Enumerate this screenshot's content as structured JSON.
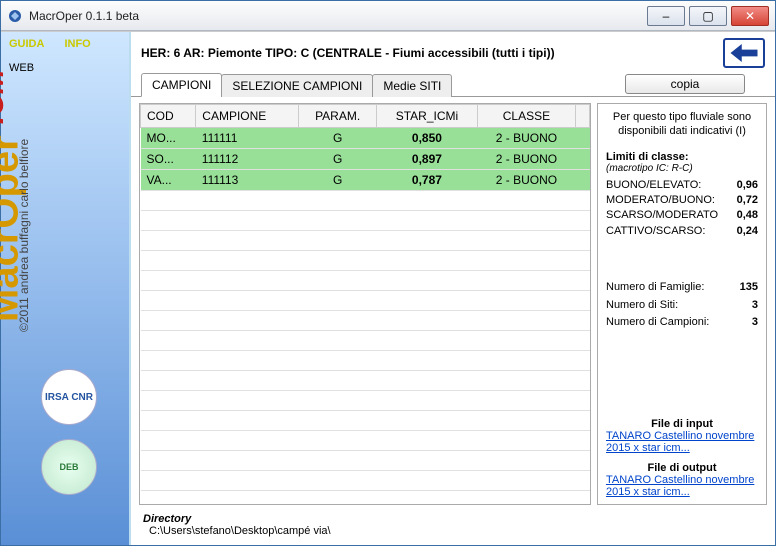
{
  "window": {
    "title": "MacrOper 0.1.1 beta"
  },
  "sidebar": {
    "guida": "GUIDA",
    "info": "INFO",
    "web": "WEB",
    "app_name_main": "MacrOper",
    "app_name_sub": "ICM",
    "copyright": "©2011 andrea buffagni  carlo belfiore",
    "badge_irsa": "IRSA CNR",
    "badge_deb": "DEB"
  },
  "header": {
    "text": "HER: 6  AR: Piemonte   TIPO: C (CENTRALE - Fiumi accessibili (tutti i tipi))"
  },
  "tabs": {
    "campioni": "CAMPIONI",
    "selezione": "SELEZIONE CAMPIONI",
    "medie": "Medie SITI",
    "copia": "copia"
  },
  "table": {
    "headers": {
      "cod": "COD",
      "campione": "CAMPIONE",
      "param": "PARAM.",
      "star": "STAR_ICMi",
      "classe": "CLASSE"
    },
    "rows": [
      {
        "cod": "MO...",
        "campione": "111111",
        "param": "G",
        "star": "0,850",
        "classe": "2 - BUONO"
      },
      {
        "cod": "SO...",
        "campione": "111112",
        "param": "G",
        "star": "0,897",
        "classe": "2 - BUONO"
      },
      {
        "cod": "VA...",
        "campione": "111113",
        "param": "G",
        "star": "0,787",
        "classe": "2 - BUONO"
      }
    ]
  },
  "info": {
    "note": "Per questo tipo fluviale sono disponibili dati indicativi (I)",
    "lim_title": "Limiti di classe:",
    "lim_sub": "(macrotipo IC: R-C)",
    "limits": [
      {
        "label": "BUONO/ELEVATO:",
        "val": "0,96"
      },
      {
        "label": "MODERATO/BUONO:",
        "val": "0,72"
      },
      {
        "label": "SCARSO/MODERATO",
        "val": "0,48"
      },
      {
        "label": "CATTIVO/SCARSO:",
        "val": "0,24"
      }
    ],
    "stats": [
      {
        "label": "Numero di Famiglie:",
        "val": "135"
      },
      {
        "label": "Numero di Siti:",
        "val": "3"
      },
      {
        "label": "Numero di Campioni:",
        "val": "3"
      }
    ],
    "file_input_label": "File di input",
    "file_input_link": "TANARO Castellino novembre 2015 x star icm...",
    "file_output_label": "File di output",
    "file_output_link": "TANARO Castellino novembre 2015 x star icm..."
  },
  "footer": {
    "label": "Directory",
    "path": "C:\\Users\\stefano\\Desktop\\campé via\\"
  }
}
